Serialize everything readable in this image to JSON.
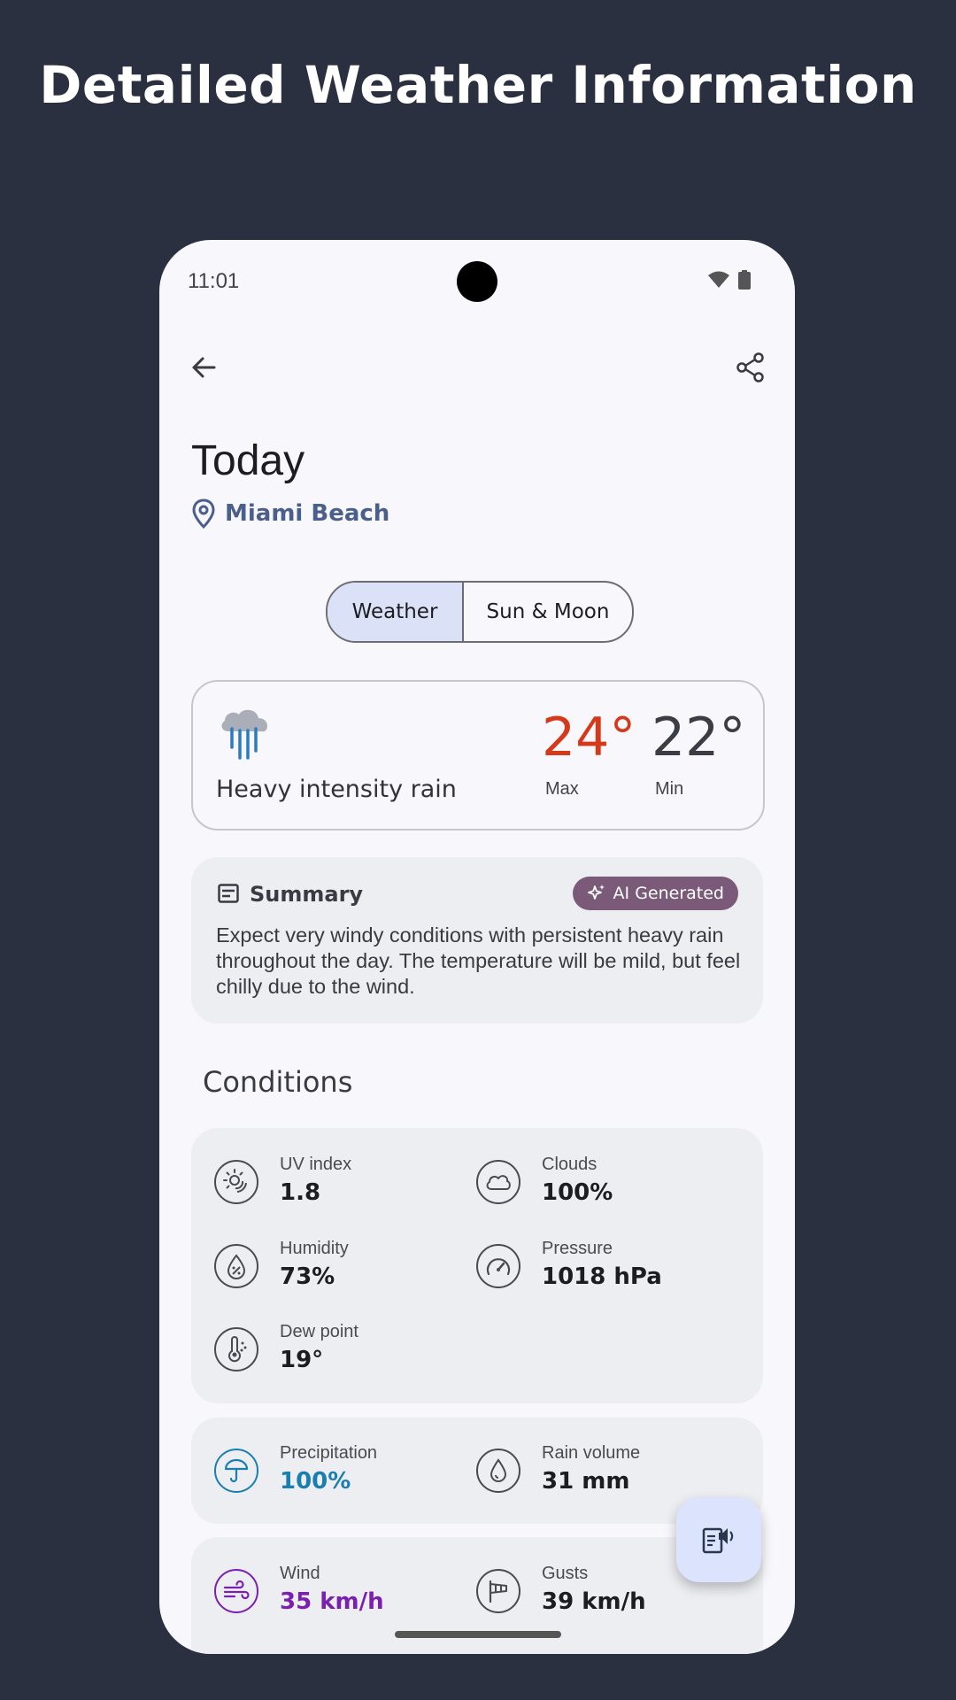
{
  "promo": {
    "title": "Detailed Weather Information"
  },
  "status_bar": {
    "time": "11:01",
    "icons": [
      "wifi-icon",
      "battery-icon"
    ]
  },
  "header": {
    "back_icon": "arrow-back-icon",
    "share_icon": "share-icon"
  },
  "page": {
    "title": "Today",
    "location": "Miami Beach"
  },
  "tabs": [
    {
      "label": "Weather",
      "selected": true
    },
    {
      "label": "Sun & Moon",
      "selected": false
    }
  ],
  "weather_card": {
    "icon": "heavy-rain-icon",
    "description": "Heavy intensity rain",
    "max": "24°",
    "max_label": "Max",
    "min": "22°",
    "min_label": "Min"
  },
  "summary": {
    "title": "Summary",
    "badge": "AI Generated",
    "text": "Expect very windy conditions with persistent heavy rain throughout the day.  The temperature will be mild, but feel chilly due to the wind."
  },
  "conditions": {
    "title": "Conditions",
    "group1": [
      {
        "label": "UV index",
        "value": "1.8",
        "icon": "uv-icon"
      },
      {
        "label": "Clouds",
        "value": "100%",
        "icon": "cloud-icon"
      },
      {
        "label": "Humidity",
        "value": "73%",
        "icon": "humidity-icon"
      },
      {
        "label": "Pressure",
        "value": "1018 hPa",
        "icon": "gauge-icon"
      },
      {
        "label": "Dew point",
        "value": "19°",
        "icon": "thermometer-icon"
      }
    ],
    "group2": [
      {
        "label": "Precipitation",
        "value": "100%",
        "icon": "umbrella-icon"
      },
      {
        "label": "Rain volume",
        "value": "31 mm",
        "icon": "raindrop-icon"
      }
    ],
    "group3": [
      {
        "label": "Wind",
        "value": "35 km/h",
        "icon": "wind-icon"
      },
      {
        "label": "Gusts",
        "value": "39 km/h",
        "icon": "windsock-icon"
      }
    ]
  },
  "colors": {
    "max_temp": "#d5391a",
    "precipitation": "#1a7fb0",
    "wind": "#7a1fb0",
    "ai_badge": "#7a5a78",
    "location": "#4a5f8c"
  },
  "fab": {
    "icon": "read-aloud-icon"
  }
}
